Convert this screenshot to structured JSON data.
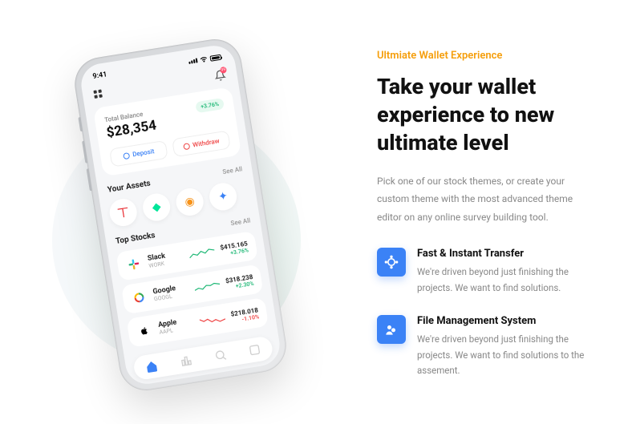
{
  "phone": {
    "time": "9:41",
    "bell_badge": "99",
    "balance": {
      "label": "Total Balance",
      "amount": "$28,354",
      "change_badge": "+3.76%",
      "deposit_label": "Deposit",
      "withdraw_label": "Withdraw"
    },
    "assets": {
      "title": "Your Assets",
      "see_all": "See All"
    },
    "stocks": {
      "title": "Top Stocks",
      "see_all": "See All",
      "items": [
        {
          "name": "Slack",
          "ticker": "WORK",
          "price": "$415.165",
          "change": "+3.76%",
          "dir": "up"
        },
        {
          "name": "Google",
          "ticker": "GOOGL",
          "price": "$318.238",
          "change": "+2.30%",
          "dir": "up"
        },
        {
          "name": "Apple",
          "ticker": "AAPL",
          "price": "$218.018",
          "change": "-1.10%",
          "dir": "down"
        }
      ]
    }
  },
  "marketing": {
    "eyebrow": "Ultmiate Wallet Experience",
    "headline": "Take your wallet experience to new ultimate level",
    "sub": "Pick one of our stock themes, or create your custom theme with the most advanced theme editor on any online survey building tool.",
    "features": [
      {
        "title": "Fast & Instant Transfer",
        "desc": "We're driven beyond just finishing the projects. We want to find solutions."
      },
      {
        "title": "File Management System",
        "desc": "We're driven beyond just finishing the projects. We want to find solutions to the assement."
      }
    ]
  }
}
